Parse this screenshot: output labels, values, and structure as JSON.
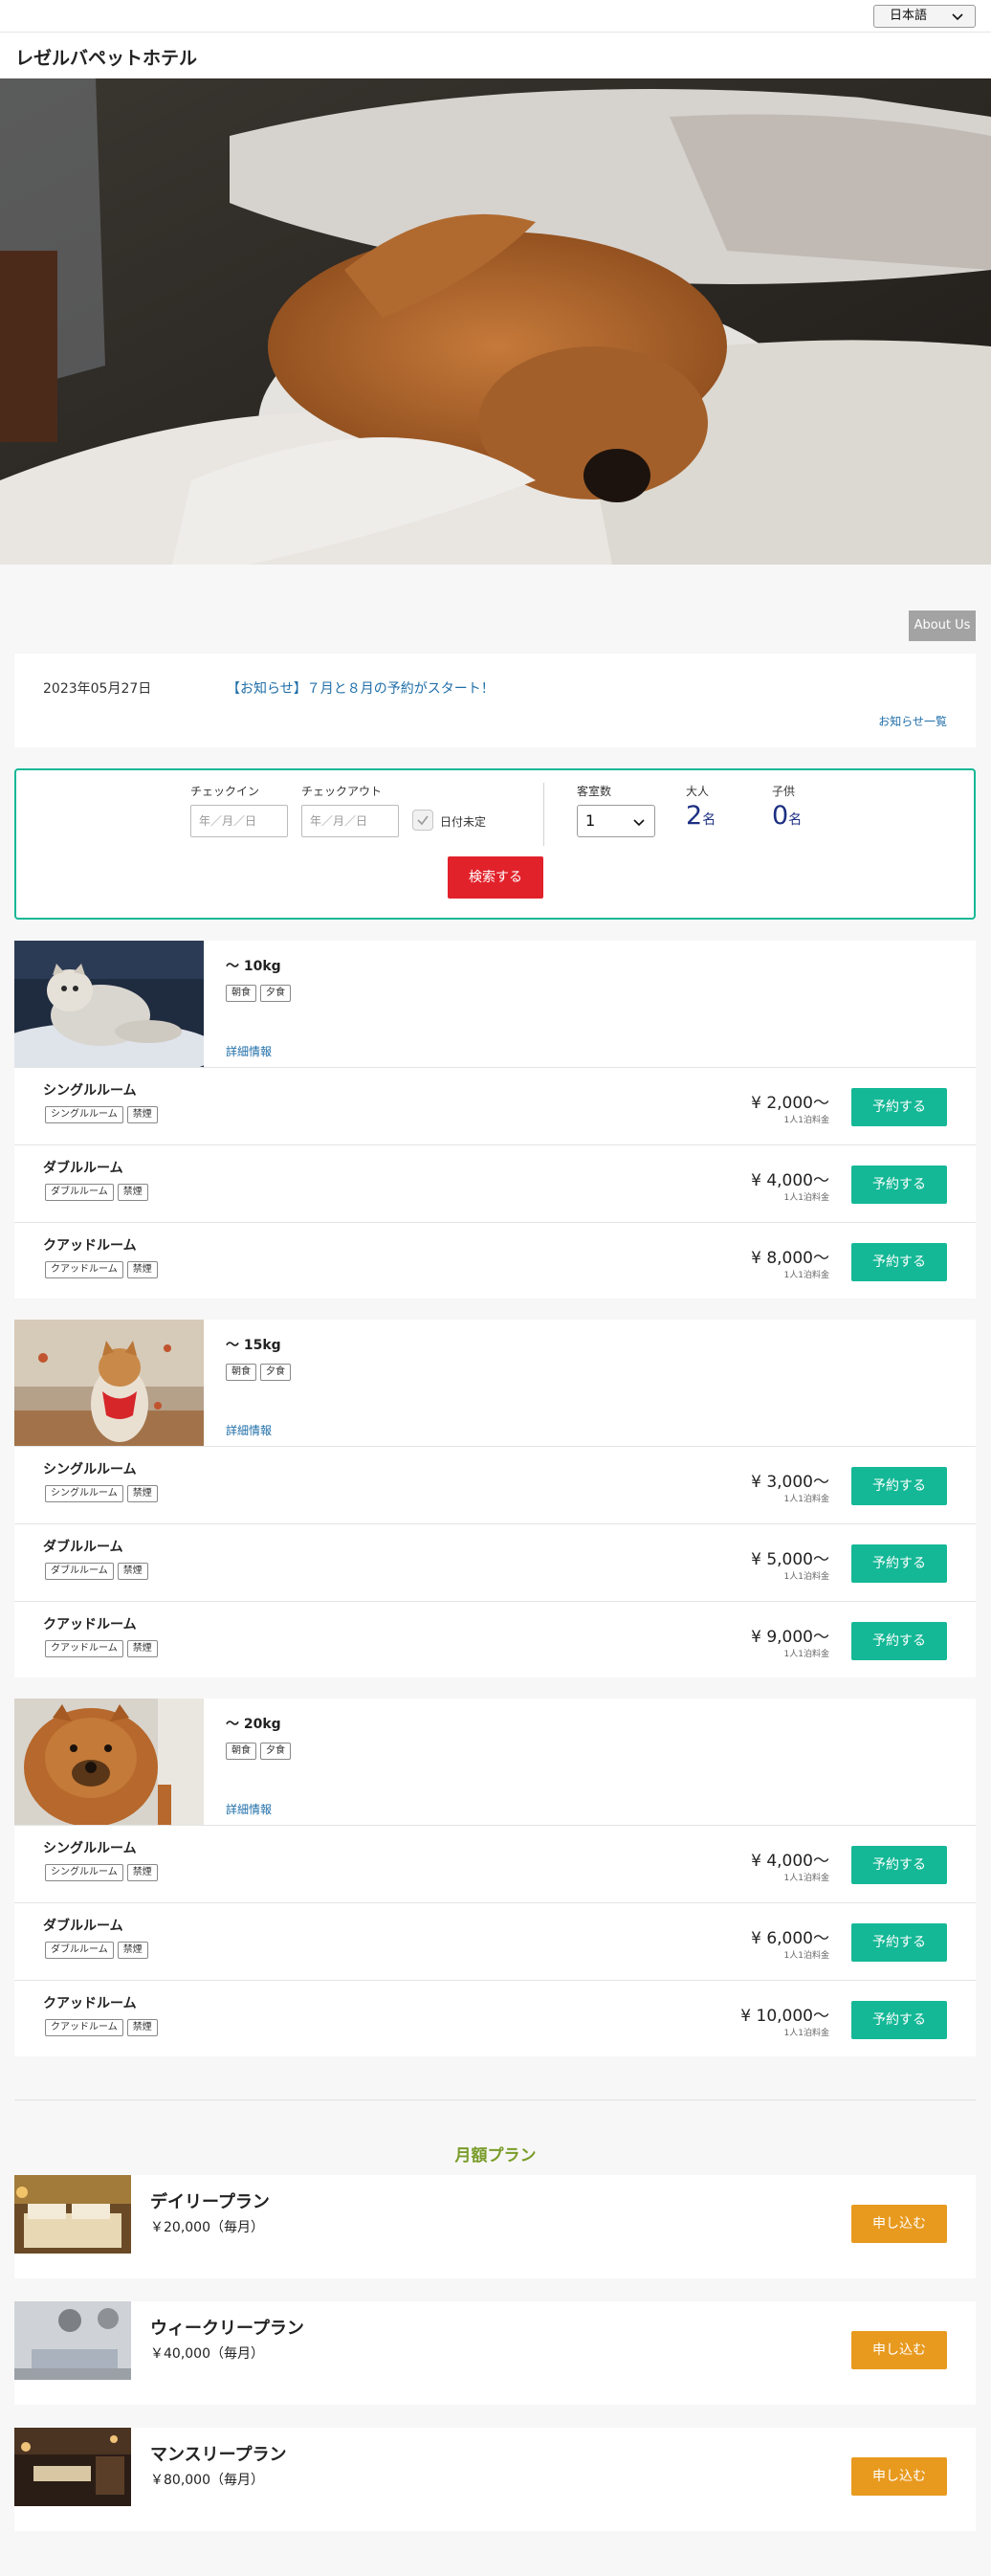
{
  "language": {
    "selected": "日本語"
  },
  "site": {
    "title": "レゼルバペットホテル"
  },
  "about_label": "About Us",
  "news": {
    "date": "2023年05月27日",
    "title": "【お知らせ】７月と８月の予約がスタート！",
    "more_label": "お知らせ一覧"
  },
  "search": {
    "checkin_label": "チェックイン",
    "checkin_placeholder": "年／月／日",
    "checkout_label": "チェックアウト",
    "checkout_placeholder": "年／月／日",
    "undecided_label": "日付未定",
    "rooms_label": "客室数",
    "rooms_value": "1",
    "adults_label": "大人",
    "adults_value": "2",
    "children_label": "子供",
    "children_value": "0",
    "person_unit": "名",
    "search_label": "検索する"
  },
  "pets": [
    {
      "size": "〜 10kg",
      "meals": [
        "朝食",
        "夕食"
      ],
      "detail_label": "詳細情報",
      "rooms": [
        {
          "name": "シングルルーム",
          "tags": [
            "シングルルーム",
            "禁煙"
          ],
          "price": "¥ 2,000〜",
          "unit": "1人1泊料金",
          "book_label": "予約する"
        },
        {
          "name": "ダブルルーム",
          "tags": [
            "ダブルルーム",
            "禁煙"
          ],
          "price": "¥ 4,000〜",
          "unit": "1人1泊料金",
          "book_label": "予約する"
        },
        {
          "name": "クアッドルーム",
          "tags": [
            "クアッドルーム",
            "禁煙"
          ],
          "price": "¥ 8,000〜",
          "unit": "1人1泊料金",
          "book_label": "予約する"
        }
      ]
    },
    {
      "size": "〜 15kg",
      "meals": [
        "朝食",
        "夕食"
      ],
      "detail_label": "詳細情報",
      "rooms": [
        {
          "name": "シングルルーム",
          "tags": [
            "シングルルーム",
            "禁煙"
          ],
          "price": "¥ 3,000〜",
          "unit": "1人1泊料金",
          "book_label": "予約する"
        },
        {
          "name": "ダブルルーム",
          "tags": [
            "ダブルルーム",
            "禁煙"
          ],
          "price": "¥ 5,000〜",
          "unit": "1人1泊料金",
          "book_label": "予約する"
        },
        {
          "name": "クアッドルーム",
          "tags": [
            "クアッドルーム",
            "禁煙"
          ],
          "price": "¥ 9,000〜",
          "unit": "1人1泊料金",
          "book_label": "予約する"
        }
      ]
    },
    {
      "size": "〜 20kg",
      "meals": [
        "朝食",
        "夕食"
      ],
      "detail_label": "詳細情報",
      "rooms": [
        {
          "name": "シングルルーム",
          "tags": [
            "シングルルーム",
            "禁煙"
          ],
          "price": "¥ 4,000〜",
          "unit": "1人1泊料金",
          "book_label": "予約する"
        },
        {
          "name": "ダブルルーム",
          "tags": [
            "ダブルルーム",
            "禁煙"
          ],
          "price": "¥ 6,000〜",
          "unit": "1人1泊料金",
          "book_label": "予約する"
        },
        {
          "name": "クアッドルーム",
          "tags": [
            "クアッドルーム",
            "禁煙"
          ],
          "price": "¥ 10,000〜",
          "unit": "1人1泊料金",
          "book_label": "予約する"
        }
      ]
    }
  ],
  "plans_title": "月額プラン",
  "plans": [
    {
      "name": "デイリープラン",
      "price": "￥20,000（毎月）",
      "apply_label": "申し込む"
    },
    {
      "name": "ウィークリープラン",
      "price": "￥40,000（毎月）",
      "apply_label": "申し込む"
    },
    {
      "name": "マンスリープラン",
      "price": "￥80,000（毎月）",
      "apply_label": "申し込む"
    }
  ],
  "colors": {
    "accent_green": "#14b896",
    "search_red": "#e2222b",
    "apply_orange": "#e89a1f",
    "link_blue": "#1f6ea8",
    "plans_title_green": "#7a9c2a"
  }
}
